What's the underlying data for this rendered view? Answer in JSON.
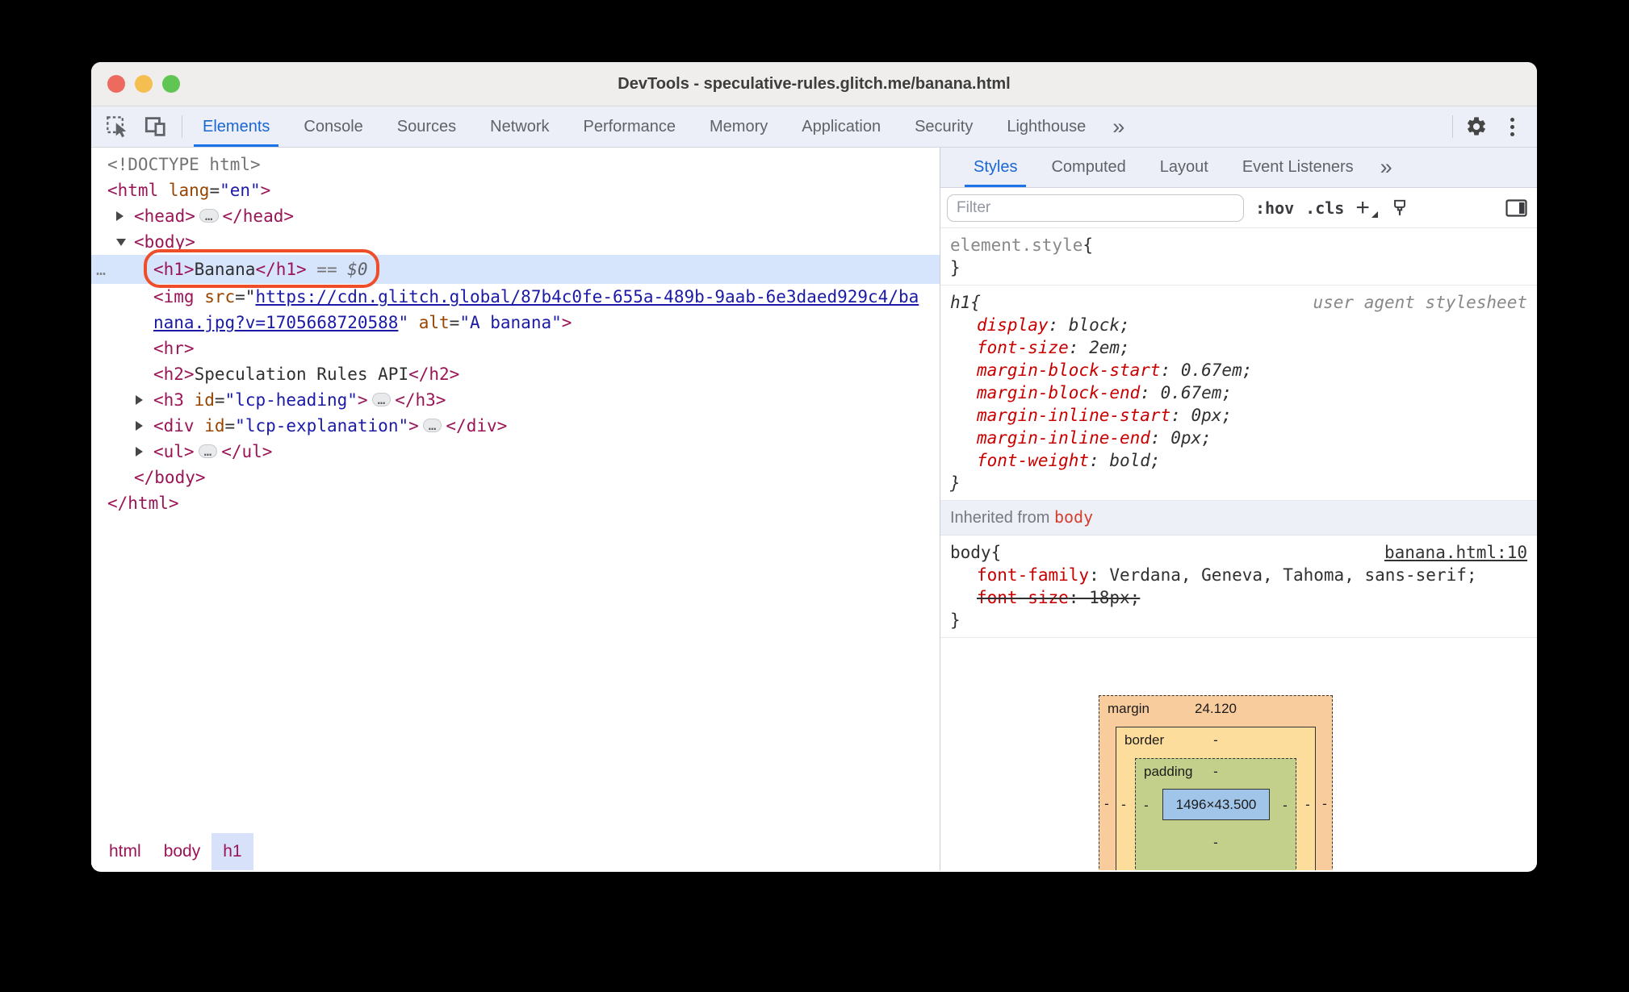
{
  "colors": {
    "accent_blue": "#1a73e8",
    "tag": "#9a1556",
    "attr_name": "#994500",
    "attr_value": "#1a1aa6",
    "css_property": "#c80000",
    "annotation_orange": "#ee4e2a",
    "selection_bg": "#d6e4fc",
    "box_margin": "#f9cc9d",
    "box_border": "#fddd9b",
    "box_padding": "#c3d08b",
    "box_content": "#a0c5e8"
  },
  "window": {
    "title": "DevTools - speculative-rules.glitch.me/banana.html"
  },
  "toolbar": {
    "tabs": [
      "Elements",
      "Console",
      "Sources",
      "Network",
      "Performance",
      "Memory",
      "Application",
      "Security",
      "Lighthouse"
    ],
    "selected_tab": "Elements",
    "overflow_label": "»"
  },
  "dom_tree": {
    "lines": [
      {
        "indent": 0,
        "segments": [
          {
            "t": "gray",
            "v": "<!DOCTYPE html>"
          }
        ]
      },
      {
        "indent": 0,
        "segments": [
          {
            "t": "tag",
            "v": "<html"
          },
          {
            "t": "attr",
            "v": " lang"
          },
          {
            "t": "eq",
            "v": "="
          },
          {
            "t": "val",
            "v": "\"en\""
          },
          {
            "t": "tag",
            "v": ">"
          }
        ]
      },
      {
        "indent": 1,
        "arrow": "right",
        "segments": [
          {
            "t": "tag",
            "v": "<head>"
          },
          {
            "t": "pill",
            "v": "…"
          },
          {
            "t": "tag",
            "v": "</head>"
          }
        ]
      },
      {
        "indent": 1,
        "arrow": "down",
        "segments": [
          {
            "t": "tag",
            "v": "<body>"
          }
        ]
      },
      {
        "indent": 2,
        "selected": true,
        "annotated": true,
        "gutter": "…",
        "segments": [
          {
            "t": "tag",
            "v": "<h1>"
          },
          {
            "t": "text",
            "v": "Banana"
          },
          {
            "t": "tag",
            "v": "</h1>"
          },
          {
            "t": "gray",
            "v": " == "
          },
          {
            "t": "dollar",
            "v": "$0"
          }
        ]
      },
      {
        "indent": 2,
        "segments": [
          {
            "t": "tag",
            "v": "<img"
          },
          {
            "t": "attr",
            "v": " src"
          },
          {
            "t": "eq",
            "v": "=\""
          },
          {
            "t": "link",
            "v": "https://cdn.glitch.global/87b4c0fe-655a-489b-9aab-6e3daed929c4/ba"
          }
        ]
      },
      {
        "indent": 2,
        "segments": [
          {
            "t": "link",
            "v": "nana.jpg?v=1705668720588"
          },
          {
            "t": "val",
            "v": "\""
          },
          {
            "t": "attr",
            "v": " alt"
          },
          {
            "t": "eq",
            "v": "="
          },
          {
            "t": "val",
            "v": "\"A banana\""
          },
          {
            "t": "tag",
            "v": ">"
          }
        ]
      },
      {
        "indent": 2,
        "segments": [
          {
            "t": "tag",
            "v": "<hr>"
          }
        ]
      },
      {
        "indent": 2,
        "segments": [
          {
            "t": "tag",
            "v": "<h2>"
          },
          {
            "t": "text",
            "v": "Speculation Rules API"
          },
          {
            "t": "tag",
            "v": "</h2>"
          }
        ]
      },
      {
        "indent": 2,
        "arrow": "right",
        "segments": [
          {
            "t": "tag",
            "v": "<h3"
          },
          {
            "t": "attr",
            "v": " id"
          },
          {
            "t": "eq",
            "v": "="
          },
          {
            "t": "val",
            "v": "\"lcp-heading\""
          },
          {
            "t": "tag",
            "v": ">"
          },
          {
            "t": "pill",
            "v": "…"
          },
          {
            "t": "tag",
            "v": "</h3>"
          }
        ]
      },
      {
        "indent": 2,
        "arrow": "right",
        "segments": [
          {
            "t": "tag",
            "v": "<div"
          },
          {
            "t": "attr",
            "v": " id"
          },
          {
            "t": "eq",
            "v": "="
          },
          {
            "t": "val",
            "v": "\"lcp-explanation\""
          },
          {
            "t": "tag",
            "v": ">"
          },
          {
            "t": "pill",
            "v": "…"
          },
          {
            "t": "tag",
            "v": "</div>"
          }
        ]
      },
      {
        "indent": 2,
        "arrow": "right",
        "segments": [
          {
            "t": "tag",
            "v": "<ul>"
          },
          {
            "t": "pill",
            "v": "…"
          },
          {
            "t": "tag",
            "v": "</ul>"
          }
        ]
      },
      {
        "indent": 1,
        "segments": [
          {
            "t": "tag",
            "v": "</body>"
          }
        ]
      },
      {
        "indent": 0,
        "segments": [
          {
            "t": "tag",
            "v": "</html>"
          }
        ]
      }
    ]
  },
  "breadcrumbs": [
    {
      "label": "html",
      "selected": false
    },
    {
      "label": "body",
      "selected": false
    },
    {
      "label": "h1",
      "selected": true
    }
  ],
  "styles_panel": {
    "tabs": [
      "Styles",
      "Computed",
      "Layout",
      "Event Listeners"
    ],
    "selected_tab": "Styles",
    "overflow_label": "»",
    "filter_placeholder": "Filter",
    "pseudo_button": ":hov",
    "class_button": ".cls",
    "sections": [
      {
        "type": "rule",
        "selector": "element.style",
        "selector_muted": true,
        "props": []
      },
      {
        "type": "rule",
        "selector": "h1",
        "italic": true,
        "origin": "user agent stylesheet",
        "props": [
          {
            "name": "display",
            "value": "block"
          },
          {
            "name": "font-size",
            "value": "2em"
          },
          {
            "name": "margin-block-start",
            "value": "0.67em"
          },
          {
            "name": "margin-block-end",
            "value": "0.67em"
          },
          {
            "name": "margin-inline-start",
            "value": "0px"
          },
          {
            "name": "margin-inline-end",
            "value": "0px"
          },
          {
            "name": "font-weight",
            "value": "bold"
          }
        ]
      },
      {
        "type": "inherited",
        "prefix": "Inherited from",
        "link": "body"
      },
      {
        "type": "rule",
        "selector": "body",
        "origin_link": "banana.html:10",
        "props": [
          {
            "name": "font-family",
            "value": "Verdana, Geneva, Tahoma, sans-serif"
          },
          {
            "name": "font-size",
            "value": "18px",
            "struck": true
          }
        ]
      }
    ]
  },
  "box_model": {
    "margin_label": "margin",
    "margin_top": "24.120",
    "border_label": "border",
    "border_top": "-",
    "padding_label": "padding",
    "padding_top": "-",
    "content": "1496×43.500",
    "margin_left": "-",
    "border_left": "-",
    "padding_left": "-",
    "padding_right": "-",
    "border_right": "-",
    "margin_right": "-",
    "padding_bottom": "-",
    "border_bottom": "-"
  }
}
